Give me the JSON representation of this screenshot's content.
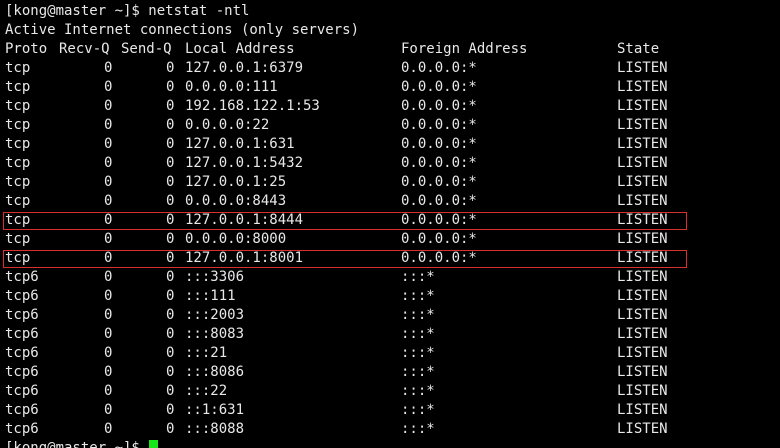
{
  "terminal": {
    "prompt": "[kong@master ~]$ ",
    "command": "netstat -ntl",
    "cursor_color": "#19e619",
    "highlight_color": "#d9302b",
    "heading": "Active Internet connections (only servers)",
    "headers": {
      "proto": "Proto",
      "recvq": "Recv-Q",
      "sendq": "Send-Q",
      "local": "Local Address",
      "foreign": "Foreign Address",
      "state": "State"
    },
    "rows": [
      {
        "proto": "tcp",
        "recvq": "0",
        "sendq": "0",
        "local": "127.0.0.1:6379",
        "foreign": "0.0.0.0:*",
        "state": "LISTEN",
        "highlighted": false
      },
      {
        "proto": "tcp",
        "recvq": "0",
        "sendq": "0",
        "local": "0.0.0.0:111",
        "foreign": "0.0.0.0:*",
        "state": "LISTEN",
        "highlighted": false
      },
      {
        "proto": "tcp",
        "recvq": "0",
        "sendq": "0",
        "local": "192.168.122.1:53",
        "foreign": "0.0.0.0:*",
        "state": "LISTEN",
        "highlighted": false
      },
      {
        "proto": "tcp",
        "recvq": "0",
        "sendq": "0",
        "local": "0.0.0.0:22",
        "foreign": "0.0.0.0:*",
        "state": "LISTEN",
        "highlighted": false
      },
      {
        "proto": "tcp",
        "recvq": "0",
        "sendq": "0",
        "local": "127.0.0.1:631",
        "foreign": "0.0.0.0:*",
        "state": "LISTEN",
        "highlighted": false
      },
      {
        "proto": "tcp",
        "recvq": "0",
        "sendq": "0",
        "local": "127.0.0.1:5432",
        "foreign": "0.0.0.0:*",
        "state": "LISTEN",
        "highlighted": false
      },
      {
        "proto": "tcp",
        "recvq": "0",
        "sendq": "0",
        "local": "127.0.0.1:25",
        "foreign": "0.0.0.0:*",
        "state": "LISTEN",
        "highlighted": false
      },
      {
        "proto": "tcp",
        "recvq": "0",
        "sendq": "0",
        "local": "0.0.0.0:8443",
        "foreign": "0.0.0.0:*",
        "state": "LISTEN",
        "highlighted": false
      },
      {
        "proto": "tcp",
        "recvq": "0",
        "sendq": "0",
        "local": "127.0.0.1:8444",
        "foreign": "0.0.0.0:*",
        "state": "LISTEN",
        "highlighted": true
      },
      {
        "proto": "tcp",
        "recvq": "0",
        "sendq": "0",
        "local": "0.0.0.0:8000",
        "foreign": "0.0.0.0:*",
        "state": "LISTEN",
        "highlighted": false
      },
      {
        "proto": "tcp",
        "recvq": "0",
        "sendq": "0",
        "local": "127.0.0.1:8001",
        "foreign": "0.0.0.0:*",
        "state": "LISTEN",
        "highlighted": true
      },
      {
        "proto": "tcp6",
        "recvq": "0",
        "sendq": "0",
        "local": ":::3306",
        "foreign": ":::*",
        "state": "LISTEN",
        "highlighted": false
      },
      {
        "proto": "tcp6",
        "recvq": "0",
        "sendq": "0",
        "local": ":::111",
        "foreign": ":::*",
        "state": "LISTEN",
        "highlighted": false
      },
      {
        "proto": "tcp6",
        "recvq": "0",
        "sendq": "0",
        "local": ":::2003",
        "foreign": ":::*",
        "state": "LISTEN",
        "highlighted": false
      },
      {
        "proto": "tcp6",
        "recvq": "0",
        "sendq": "0",
        "local": ":::8083",
        "foreign": ":::*",
        "state": "LISTEN",
        "highlighted": false
      },
      {
        "proto": "tcp6",
        "recvq": "0",
        "sendq": "0",
        "local": ":::21",
        "foreign": ":::*",
        "state": "LISTEN",
        "highlighted": false
      },
      {
        "proto": "tcp6",
        "recvq": "0",
        "sendq": "0",
        "local": ":::8086",
        "foreign": ":::*",
        "state": "LISTEN",
        "highlighted": false
      },
      {
        "proto": "tcp6",
        "recvq": "0",
        "sendq": "0",
        "local": ":::22",
        "foreign": ":::*",
        "state": "LISTEN",
        "highlighted": false
      },
      {
        "proto": "tcp6",
        "recvq": "0",
        "sendq": "0",
        "local": "::1:631",
        "foreign": ":::*",
        "state": "LISTEN",
        "highlighted": false
      },
      {
        "proto": "tcp6",
        "recvq": "0",
        "sendq": "0",
        "local": ":::8088",
        "foreign": ":::*",
        "state": "LISTEN",
        "highlighted": false
      }
    ]
  }
}
